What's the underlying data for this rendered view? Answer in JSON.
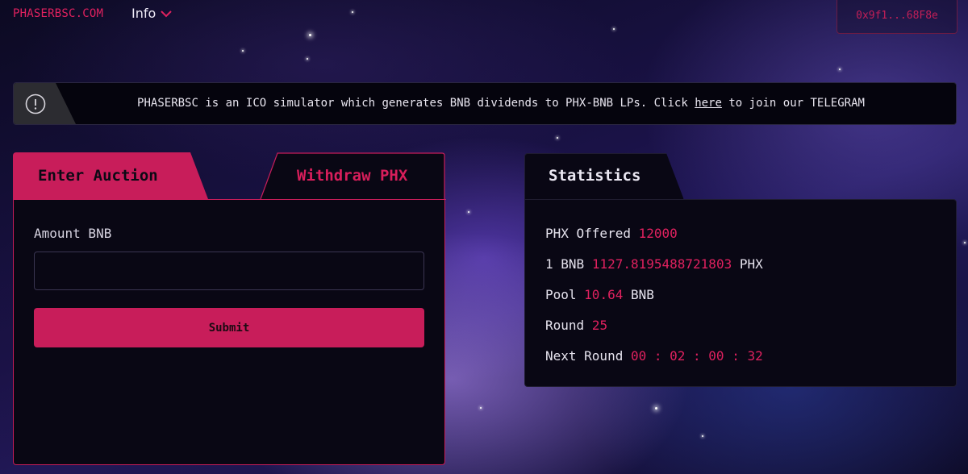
{
  "header": {
    "brand": "PHASERBSC.COM",
    "info_menu_label": "Info",
    "wallet_address": "0x9f1...68F8e"
  },
  "banner": {
    "text_before_link": "PHASERBSC is an ICO simulator which generates BNB dividends to PHX-BNB LPs. Click ",
    "link_text": "here",
    "text_after_link": " to join our TELEGRAM"
  },
  "auction": {
    "tabs": {
      "enter": "Enter Auction",
      "withdraw": "Withdraw PHX"
    },
    "active_tab": "enter",
    "amount_label": "Amount BNB",
    "amount_value": "",
    "submit_label": "Submit"
  },
  "statistics": {
    "title": "Statistics",
    "phx_offered_label": "PHX Offered",
    "phx_offered_value": "12000",
    "rate_prefix": "1 BNB",
    "rate_value": "1127.8195488721803",
    "rate_suffix": "PHX",
    "pool_label": "Pool",
    "pool_value": "10.64",
    "pool_unit": "BNB",
    "round_label": "Round",
    "round_value": "25",
    "next_round_label": "Next Round",
    "next_round_value": "00 : 02 : 00 : 32"
  },
  "colors": {
    "accent": "#c81d5a",
    "accent_text": "#e0215f",
    "panel_bg": "#090714"
  },
  "icons": {
    "info_dropdown": "chevron-down-icon",
    "banner": "exclamation-circle-icon"
  }
}
